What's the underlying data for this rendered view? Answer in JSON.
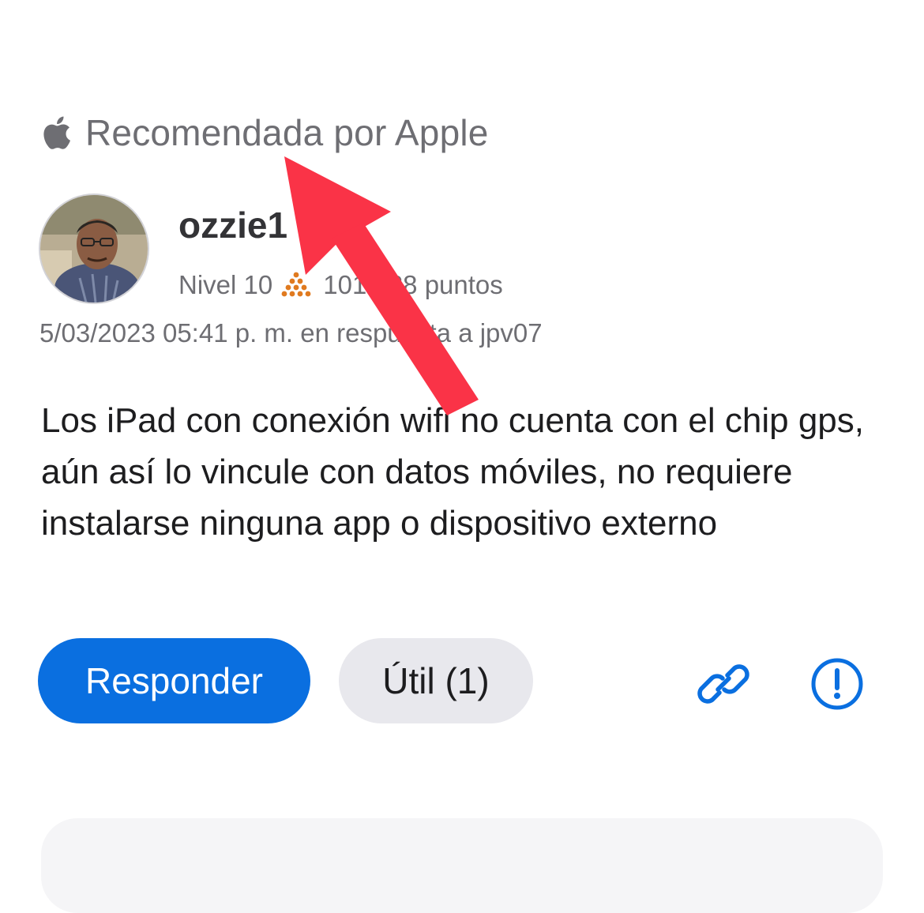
{
  "post": {
    "recommended_label": "Recomendada por Apple",
    "author": {
      "username": "ozzie1",
      "level": "Nivel 10",
      "points": "101.688 puntos",
      "avatar_icon": "user-photo"
    },
    "timestamp": "5/03/2023 05:41 p. m. en respuesta a jpv07",
    "body": "Los iPad con conexión wifi no cuenta con el chip gps, aún así lo vincule con datos móviles, no requiere instalarse ninguna app o dispositivo externo"
  },
  "actions": {
    "reply_label": "Responder",
    "useful_label": "Útil (1)",
    "link_icon": "link-icon",
    "report_icon": "report-icon"
  },
  "colors": {
    "accent": "#0a6fe0",
    "secondary_text": "#6e6e73",
    "useful_bg": "#e8e8ed",
    "level_badge": "#e07a1f",
    "annotation_arrow": "#fa3347"
  }
}
